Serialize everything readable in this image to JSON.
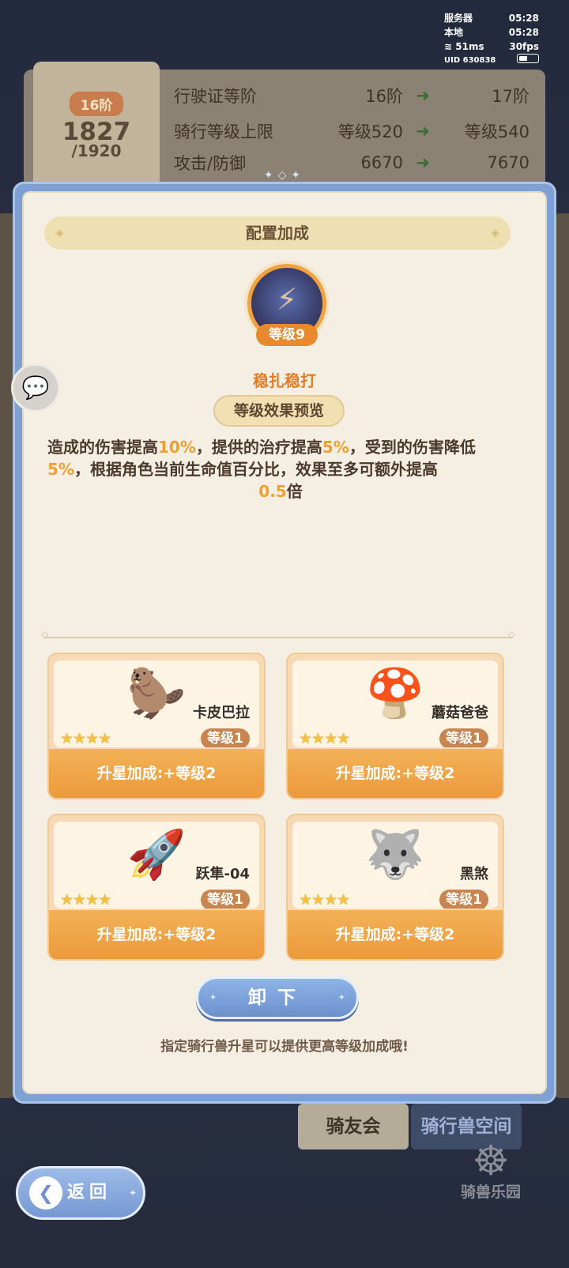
{
  "status": {
    "server_label": "服务器",
    "server_time": "05:28",
    "local_label": "本地",
    "local_time": "05:28",
    "ping": "51ms",
    "fps": "30fps",
    "uid": "UID 630838"
  },
  "background": {
    "tier": "16阶",
    "progress_current": "1827",
    "progress_total": "/1920",
    "stats": [
      {
        "label": "行驶证等阶",
        "from": "16阶",
        "to": "17阶"
      },
      {
        "label": "骑行等级上限",
        "from": "等级520",
        "to": "等级540"
      },
      {
        "label": "攻击/防御",
        "from": "6670",
        "to": "7670"
      }
    ]
  },
  "modal": {
    "title": "配置加成",
    "skill": {
      "level": "等级9",
      "name": "稳扎稳打",
      "preview_label": "等级效果预览",
      "desc_parts": [
        "造成的伤害提高",
        "10%",
        "，提供的治疗提高",
        "5%",
        "，受到的伤害降低",
        "5%",
        "，根据角色当前生命值百分比，效果至多可额外提高",
        "0.5",
        "倍"
      ]
    },
    "mounts": [
      {
        "name": "卡皮巴拉",
        "level": "等级1",
        "stars": "★★★★",
        "bonus": "升星加成:+等级2",
        "icon": "capybara-icon"
      },
      {
        "name": "蘑菇爸爸",
        "level": "等级1",
        "stars": "★★★★",
        "bonus": "升星加成:+等级2",
        "icon": "mushroom-icon"
      },
      {
        "name": "跃隼-04",
        "level": "等级1",
        "stars": "★★★★",
        "bonus": "升星加成:+等级2",
        "icon": "jet-icon"
      },
      {
        "name": "黑煞",
        "level": "等级1",
        "stars": "★★★★",
        "bonus": "升星加成:+等级2",
        "icon": "mecha-dog-icon"
      }
    ],
    "unload_label": "卸下",
    "hint": "指定骑行兽升星可以提供更高等级加成哦!"
  },
  "tabs": {
    "club": "骑友会",
    "space": "骑行兽空间",
    "park": "骑兽乐园"
  },
  "back_label": "返回"
}
